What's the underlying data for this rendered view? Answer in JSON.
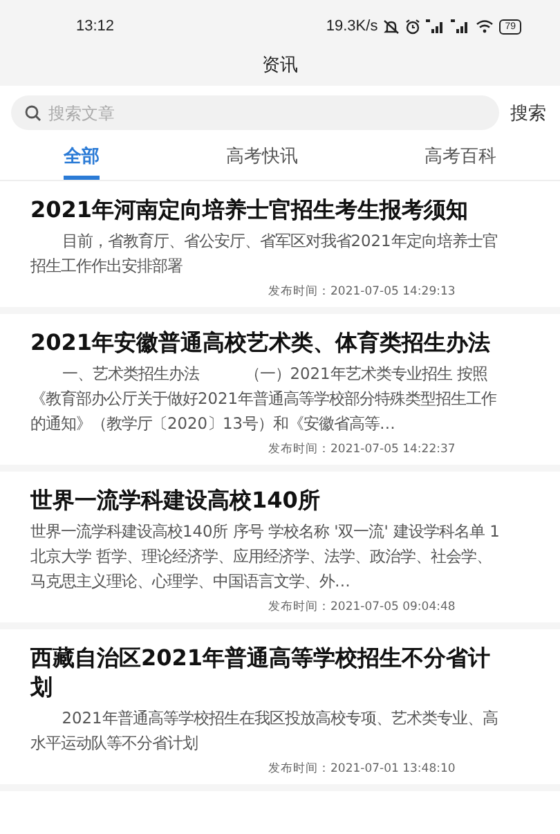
{
  "status_bar": {
    "time": "13:12",
    "speed": "19.3K/s",
    "battery": "79"
  },
  "header": {
    "title": "资讯"
  },
  "search": {
    "placeholder": "搜索文章",
    "button": "搜索"
  },
  "tabs": [
    {
      "label": "全部",
      "selected": true
    },
    {
      "label": "高考快讯",
      "selected": false
    },
    {
      "label": "高考百科",
      "selected": false
    }
  ],
  "articles": [
    {
      "title": "2021年河南定向培养士官招生考生报考须知",
      "summary": "目前，省教育厅、省公安厅、省军区对我省2021年定向培养士官招生工作作出安排部署",
      "indented": true,
      "time": "发布时间：2021-07-05 14:29:13"
    },
    {
      "title": "2021年安徽普通高校艺术类、体育类招生办法",
      "summary": "一、艺术类招生办法　　　（一）2021年艺术类专业招生 按照《教育部办公厅关于做好2021年普通高等学校部分特殊类型招生工作的通知》（教学厅〔2020〕13号）和《安徽省高等…",
      "indented": true,
      "time": "发布时间：2021-07-05 14:22:37"
    },
    {
      "title": "世界一流学科建设高校140所",
      "summary": "世界一流学科建设高校140所 序号 学校名称 '双一流' 建设学科名单 1 北京大学 哲学、理论经济学、应用经济学、法学、政治学、社会学、马克思主义理论、心理学、中国语言文学、外…",
      "indented": false,
      "time": "发布时间：2021-07-05 09:04:48"
    },
    {
      "title": "西藏自治区2021年普通高等学校招生不分省计划",
      "summary": "2021年普通高等学校招生在我区投放高校专项、艺术类专业、高水平运动队等不分省计划",
      "indented": true,
      "time": "发布时间：2021-07-01 13:48:10"
    }
  ]
}
